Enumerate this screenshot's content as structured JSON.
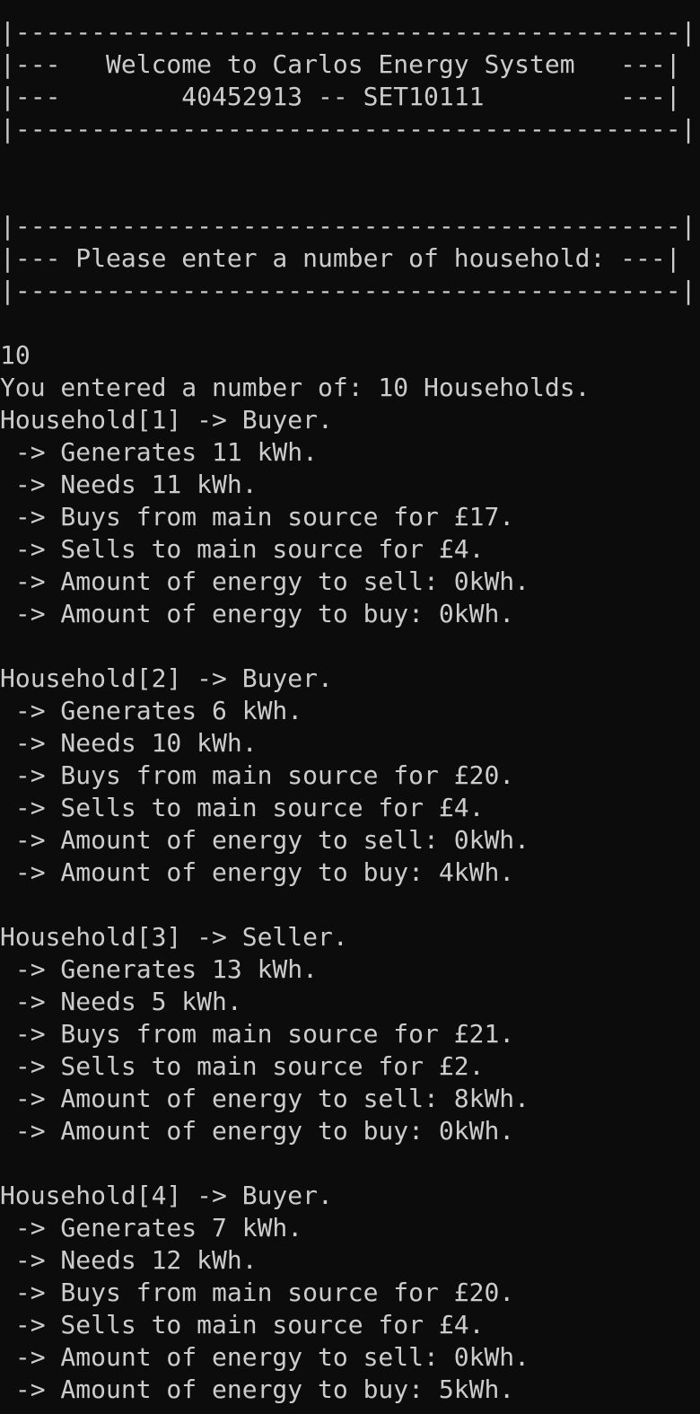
{
  "terminal": {
    "banner": [
      "|--------------------------------------------|",
      "|---   Welcome to Carlos Energy System   ---|",
      "|---        40452913 -- SET10111         ---|",
      "|--------------------------------------------|"
    ],
    "prompt_box": [
      "|--------------------------------------------|",
      "|--- Please enter a number of household: ---|",
      "|--------------------------------------------|"
    ],
    "user_input": "10",
    "confirmation": "You entered a number of: 10 Households.",
    "households": [
      {
        "header": "Household[1] -> Buyer.",
        "generates": " -> Generates 11 kWh.",
        "needs": " -> Needs 11 kWh.",
        "buys_from": " -> Buys from main source for £17.",
        "sells_to": " -> Sells to main source for £4.",
        "energy_to_sell": " -> Amount of energy to sell: 0kWh.",
        "energy_to_buy": " -> Amount of energy to buy: 0kWh."
      },
      {
        "header": "Household[2] -> Buyer.",
        "generates": " -> Generates 6 kWh.",
        "needs": " -> Needs 10 kWh.",
        "buys_from": " -> Buys from main source for £20.",
        "sells_to": " -> Sells to main source for £4.",
        "energy_to_sell": " -> Amount of energy to sell: 0kWh.",
        "energy_to_buy": " -> Amount of energy to buy: 4kWh."
      },
      {
        "header": "Household[3] -> Seller.",
        "generates": " -> Generates 13 kWh.",
        "needs": " -> Needs 5 kWh.",
        "buys_from": " -> Buys from main source for £21.",
        "sells_to": " -> Sells to main source for £2.",
        "energy_to_sell": " -> Amount of energy to sell: 8kWh.",
        "energy_to_buy": " -> Amount of energy to buy: 0kWh."
      },
      {
        "header": "Household[4] -> Buyer.",
        "generates": " -> Generates 7 kWh.",
        "needs": " -> Needs 12 kWh.",
        "buys_from": " -> Buys from main source for £20.",
        "sells_to": " -> Sells to main source for £4.",
        "energy_to_sell": " -> Amount of energy to sell: 0kWh.",
        "energy_to_buy": " -> Amount of energy to buy: 5kWh."
      }
    ]
  },
  "colors": {
    "background": "#0c0c0c",
    "text": "#cccccc"
  }
}
